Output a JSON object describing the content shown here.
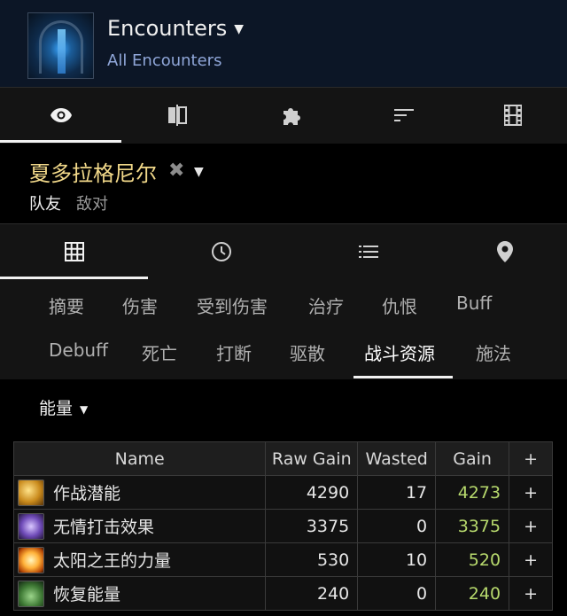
{
  "header": {
    "title": "Encounters",
    "subtitle": "All Encounters",
    "thumbnail_icon": "encounter-thumbnail"
  },
  "top_tabs": [
    {
      "icon": "eye-icon",
      "active": true
    },
    {
      "icon": "compare-icon",
      "active": false
    },
    {
      "icon": "puzzle-icon",
      "active": false
    },
    {
      "icon": "sort-icon",
      "active": false
    },
    {
      "icon": "film-icon",
      "active": false
    }
  ],
  "actor": {
    "name": "夏多拉格尼尔",
    "filter_friendly": "队友",
    "filter_enemy": "敌对"
  },
  "view_tabs": [
    {
      "icon": "grid-icon",
      "active": true
    },
    {
      "icon": "clock-icon",
      "active": false
    },
    {
      "icon": "list-icon",
      "active": false
    },
    {
      "icon": "pin-icon",
      "active": false
    }
  ],
  "categories": {
    "row1": [
      "摘要",
      "伤害",
      "受到伤害",
      "治疗",
      "仇恨",
      "Buff"
    ],
    "row2": [
      "Debuff",
      "死亡",
      "打断",
      "驱散",
      "战斗资源",
      "施法"
    ],
    "active": "战斗资源"
  },
  "resource_selector": "能量",
  "table": {
    "headers": [
      "Name",
      "Raw Gain",
      "Wasted",
      "Gain",
      "+"
    ],
    "rows": [
      {
        "name": "作战潜能",
        "raw_gain": "4290",
        "wasted": "17",
        "gain": "4273",
        "plus": "+",
        "icon": "ic-gold"
      },
      {
        "name": "无情打击效果",
        "raw_gain": "3375",
        "wasted": "0",
        "gain": "3375",
        "plus": "+",
        "icon": "ic-purple"
      },
      {
        "name": "太阳之王的力量",
        "raw_gain": "530",
        "wasted": "10",
        "gain": "520",
        "plus": "+",
        "icon": "ic-sun"
      },
      {
        "name": "恢复能量",
        "raw_gain": "240",
        "wasted": "0",
        "gain": "240",
        "plus": "+",
        "icon": "ic-cauldron"
      }
    ]
  },
  "colors": {
    "header_bg": "#0c1626",
    "subtitle": "#8fa6d8",
    "actor_name": "#f2d98a",
    "gain": "#b7d96d"
  }
}
